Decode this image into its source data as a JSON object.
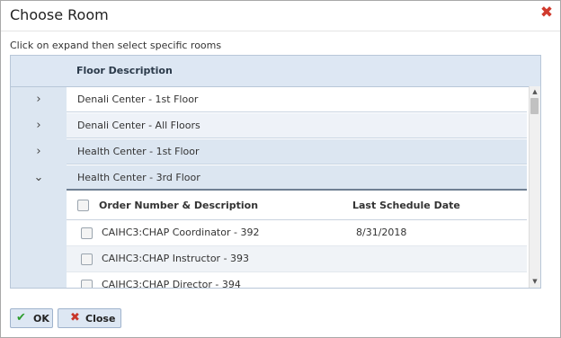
{
  "dialog": {
    "title": "Choose Room",
    "close_icon": "close-x-icon",
    "instructions": "Click on expand then select specific rooms"
  },
  "grid": {
    "header": "Floor Description",
    "floors": [
      {
        "label": "Denali Center - 1st Floor",
        "expander": "›",
        "expanded": false
      },
      {
        "label": "Denali Center - All Floors",
        "expander": "›",
        "expanded": false
      },
      {
        "label": "Health Center - 1st Floor",
        "expander": "›",
        "expanded": false
      },
      {
        "label": "Health Center - 3rd Floor",
        "expander": "⌄",
        "expanded": true
      }
    ],
    "subgrid": {
      "col1": "Order Number & Description",
      "col2": "Last Schedule Date",
      "rows": [
        {
          "desc": "CAIHC3:CHAP Coordinator - 392",
          "date": "8/31/2018"
        },
        {
          "desc": "CAIHC3:CHAP Instructor - 393",
          "date": ""
        },
        {
          "desc": "CAIHC3:CHAP Director - 394",
          "date": ""
        }
      ]
    }
  },
  "buttons": {
    "ok": {
      "label": "OK",
      "icon": "checkmark-icon"
    },
    "close": {
      "label": "Close",
      "icon": "x-icon"
    }
  },
  "colors": {
    "close_x": "#d03a2d",
    "ok_check": "#2e9d2e",
    "close_icon": "#c8362a",
    "header_bg": "#dde7f3"
  }
}
